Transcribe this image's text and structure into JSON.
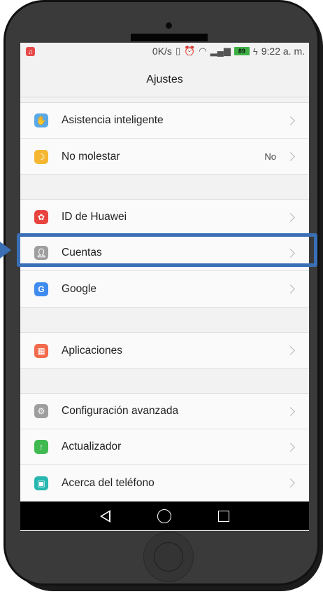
{
  "status_bar": {
    "app_icon": "music-note-icon",
    "network_speed": "0K/s",
    "battery_level": "89",
    "time": "9:22 a. m.",
    "icons": [
      "vibrate-icon",
      "alarm-icon",
      "wifi-icon",
      "signal-icon",
      "battery-icon",
      "charging-icon"
    ]
  },
  "header": {
    "title": "Ajustes"
  },
  "groups": [
    {
      "items": [
        {
          "label": "Asistencia inteligente",
          "icon": "hand-touch-icon",
          "color": "#5aa9e6"
        },
        {
          "label": "No molestar",
          "icon": "moon-icon",
          "color": "#f5b731",
          "value": "No"
        }
      ]
    },
    {
      "items": [
        {
          "label": "ID de Huawei",
          "icon": "huawei-icon",
          "color": "#e8433e"
        },
        {
          "label": "Cuentas",
          "icon": "user-icon",
          "color": "#9e9e9e"
        },
        {
          "label": "Google",
          "icon": "google-icon",
          "color": "#3f8cf0"
        }
      ]
    },
    {
      "items": [
        {
          "label": "Aplicaciones",
          "icon": "apps-grid-icon",
          "color": "#f26a4b"
        }
      ]
    },
    {
      "items": [
        {
          "label": "Configuración avanzada",
          "icon": "gear-icon",
          "color": "#9e9e9e"
        },
        {
          "label": "Actualizador",
          "icon": "arrow-up-icon",
          "color": "#3fb950"
        },
        {
          "label": "Acerca del teléfono",
          "icon": "phone-info-icon",
          "color": "#25b7b0"
        }
      ]
    }
  ],
  "highlight": {
    "target": "Cuentas",
    "color": "#3a6fb5"
  },
  "nav_bar": {
    "back": "back-triangle-icon",
    "home": "home-circle-icon",
    "recent": "recent-square-icon"
  }
}
